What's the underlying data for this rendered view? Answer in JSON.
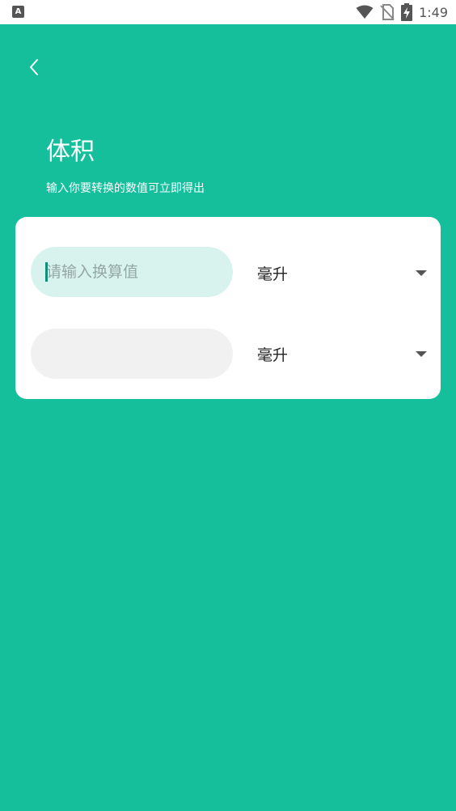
{
  "status_bar": {
    "time": "1:49",
    "app_icon_letter": "A"
  },
  "header": {
    "title": "体积",
    "subtitle": "输入你要转换的数值可立即得出"
  },
  "converter": {
    "input_placeholder": "请输入换算值",
    "input_value": "",
    "result_value": "",
    "from_unit": "毫升",
    "to_unit": "毫升"
  },
  "colors": {
    "primary": "#15bf9c",
    "input_active_bg": "#d8f3ee",
    "input_result_bg": "#f1f1f1"
  }
}
